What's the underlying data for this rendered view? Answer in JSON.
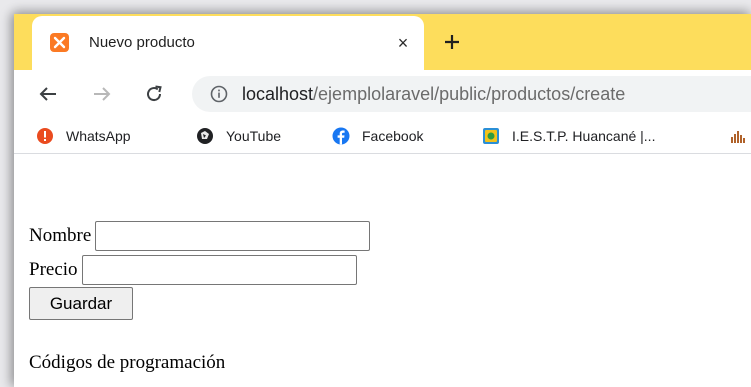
{
  "tab": {
    "title": "Nuevo producto",
    "close": "×",
    "new_tab": "+",
    "favicon": "xampp-icon"
  },
  "colors": {
    "tabstrip": "#fddd5c",
    "favicon": "#fb7a24",
    "omnibox": "#f1f3f4",
    "url_path": "#6b6b6b"
  },
  "toolbar": {
    "back": "←",
    "forward": "→",
    "reload": "C"
  },
  "address": {
    "host": "localhost",
    "path": "/ejemplolaravel/public/productos/create"
  },
  "bookmarks": [
    {
      "label": "WhatsApp",
      "icon": "whatsapp-icon"
    },
    {
      "label": "YouTube",
      "icon": "youtube-icon"
    },
    {
      "label": "Facebook",
      "icon": "facebook-icon"
    },
    {
      "label": "I.E.S.T.P. Huancané |...",
      "icon": "iestp-icon"
    }
  ],
  "form": {
    "nombre_label": "Nombre",
    "nombre_value": "",
    "precio_label": "Precio",
    "precio_value": "",
    "save_label": "Guardar"
  },
  "footer": {
    "text": "Códigos de programación"
  }
}
